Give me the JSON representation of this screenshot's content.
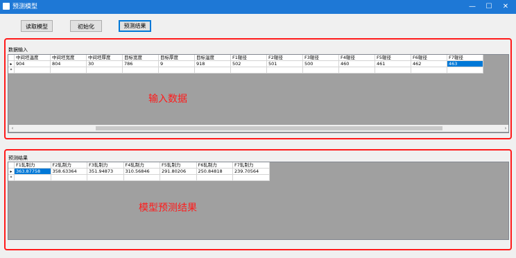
{
  "window": {
    "title": "预测模型",
    "minimize": "—",
    "maximize": "☐",
    "close": "✕"
  },
  "toolbar": {
    "read_model": "读取模型",
    "normalize": "初始化",
    "predict_result": "预测结果"
  },
  "input_group": {
    "label": "数据输入",
    "columns": [
      "中间坯温度",
      "中间坯宽度",
      "中间坯厚度",
      "目标宽度",
      "目标厚度",
      "目标温度",
      "F1辊径",
      "F2辊径",
      "F3辊径",
      "F4辊径",
      "F5辊径",
      "F6辊径",
      "F7辊径"
    ],
    "rows": [
      [
        "904",
        "804",
        "30",
        "786",
        "9",
        "918",
        "502",
        "501",
        "500",
        "460",
        "461",
        "462",
        "463"
      ]
    ],
    "row_marker": "▸",
    "new_row_marker": "*",
    "annotation": "输入数据"
  },
  "result_group": {
    "label": "预测结果",
    "columns": [
      "F1轧制力",
      "F2轧制力",
      "F3轧制力",
      "F4轧制力",
      "F5轧制力",
      "F6轧制力",
      "F7轧制力"
    ],
    "rows": [
      [
        "363.87758",
        "358.63364",
        "351.94873",
        "310.56846",
        "291.80206",
        "250.84818",
        "239.70564"
      ]
    ],
    "row_marker": "▸",
    "new_row_marker": "*",
    "annotation": "模型预测结果"
  },
  "icons": {
    "scroll_left": "‹",
    "scroll_right": "›"
  },
  "colors": {
    "titlebar": "#1e78d6",
    "selection": "#0078d7",
    "annotation": "#ff1a1a",
    "grid_bg": "#a0a0a0"
  }
}
